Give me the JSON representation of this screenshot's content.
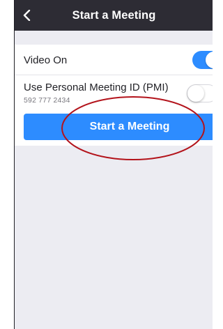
{
  "header": {
    "title": "Start a Meeting",
    "back_icon": "chevron-left-icon"
  },
  "settings": {
    "video_on": {
      "label": "Video On",
      "enabled": true
    },
    "pmi": {
      "label": "Use Personal Meeting ID (PMI)",
      "meeting_id": "592 777 2434",
      "enabled": false
    }
  },
  "start_button": {
    "label": "Start a Meeting"
  },
  "colors": {
    "header_bg": "#2d2c34",
    "accent": "#2d8cff",
    "page_bg": "#ececf2",
    "annotation": "#b3131b"
  }
}
